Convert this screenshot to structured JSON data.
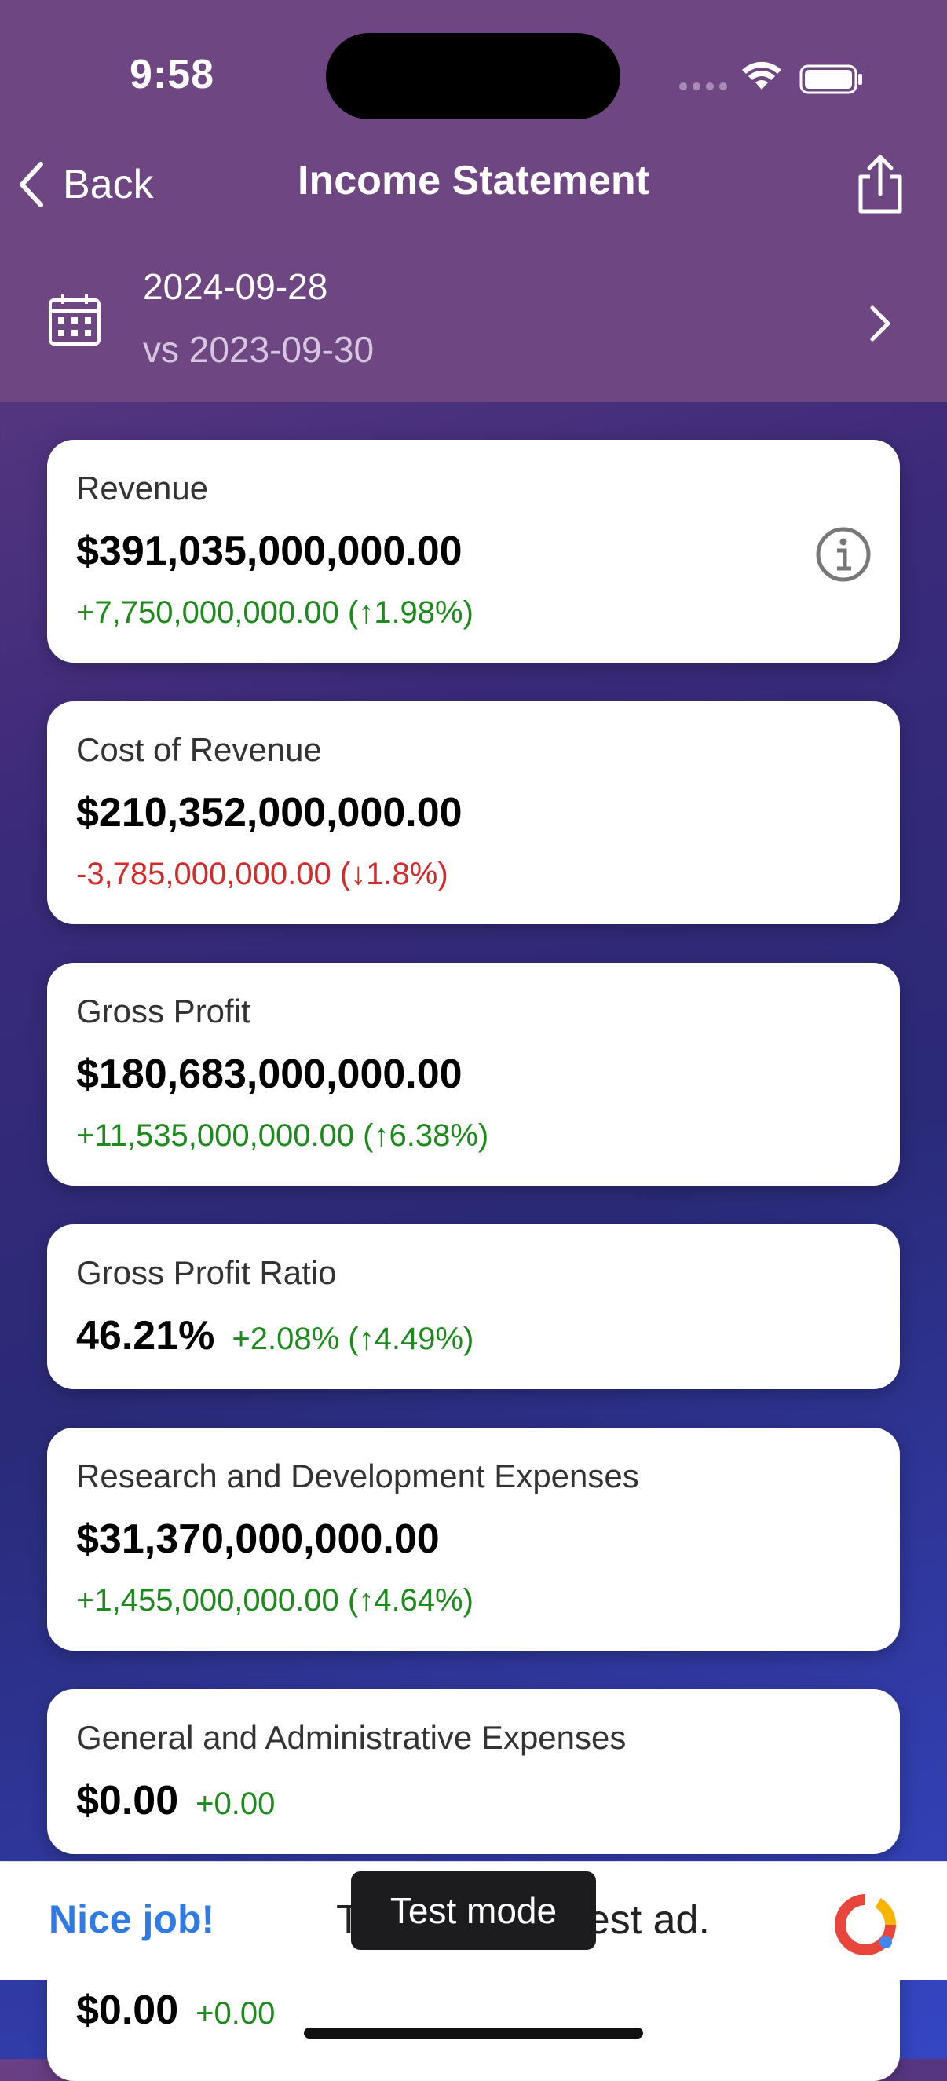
{
  "status_bar": {
    "time": "9:58"
  },
  "nav": {
    "back_label": "Back",
    "title": "Income Statement"
  },
  "date_selector": {
    "date": "2024-09-28",
    "compare": "vs 2023-09-30"
  },
  "cards": [
    {
      "label": "Revenue",
      "value": "$391,035,000,000.00",
      "change": "+7,750,000,000.00 (↑1.98%)",
      "change_color": "#1e8a1e",
      "has_info": true
    },
    {
      "label": "Cost of Revenue",
      "value": "$210,352,000,000.00",
      "change": "-3,785,000,000.00 (↓1.8%)",
      "change_color": "#d32b2b"
    },
    {
      "label": "Gross Profit",
      "value": "$180,683,000,000.00",
      "change": "+11,535,000,000.00 (↑6.38%)",
      "change_color": "#1e8a1e"
    },
    {
      "label": "Gross Profit Ratio",
      "value": "46.21%",
      "change": "+2.08% (↑4.49%)",
      "change_color": "#1e8a1e"
    },
    {
      "label": "Research and Development Expenses",
      "value": "$31,370,000,000.00",
      "change": "+1,455,000,000.00 (↑4.64%)",
      "change_color": "#1e8a1e"
    },
    {
      "label": "General and Administrative Expenses",
      "value": "$0.00",
      "change": "+0.00",
      "change_color": "#1e8a1e"
    },
    {
      "value": "$0.00",
      "change": "+0.00",
      "change_color": "#1e8a1e"
    }
  ],
  "ad": {
    "left_text": "Nice job!",
    "body_text": "T                0 test ad.",
    "toast": "Test mode"
  }
}
